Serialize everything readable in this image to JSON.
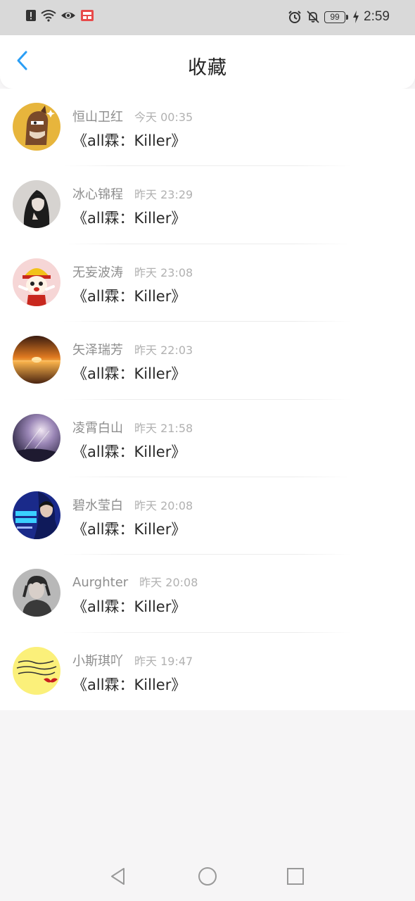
{
  "status_bar": {
    "time": "2:59",
    "battery": "99"
  },
  "header": {
    "title": "收藏"
  },
  "favorites": [
    {
      "username": "恒山卫红",
      "time": "今天 00:35",
      "title": "《all霖：Killer》",
      "avatar": "horse-avatar"
    },
    {
      "username": "冰心锦程",
      "time": "昨天 23:29",
      "title": "《all霖：Killer》",
      "avatar": "dark-hair-girl-avatar"
    },
    {
      "username": "无妄波涛",
      "time": "昨天 23:08",
      "title": "《all霖：Killer》",
      "avatar": "cartoon-kid-avatar"
    },
    {
      "username": "矢泽瑞芳",
      "time": "昨天 22:03",
      "title": "《all霖：Killer》",
      "avatar": "sunset-avatar"
    },
    {
      "username": "凌霄白山",
      "time": "昨天 21:58",
      "title": "《all霖：Killer》",
      "avatar": "sky-light-avatar"
    },
    {
      "username": "碧水莹白",
      "time": "昨天 20:08",
      "title": "《all霖：Killer》",
      "avatar": "poster-avatar"
    },
    {
      "username": "Aurghter",
      "time": "昨天 20:08",
      "title": "《all霖：Killer》",
      "avatar": "person-portrait-avatar"
    },
    {
      "username": "小斯琪吖",
      "time": "昨天 19:47",
      "title": "《all霖：Killer》",
      "avatar": "yellow-note-avatar"
    }
  ],
  "colors": {
    "accent": "#2a9ef5",
    "username": "#8e8e8e",
    "time": "#b1b1b1",
    "title": "#2a2a2a",
    "background": "#f6f5f6"
  },
  "icons": {
    "status_left": [
      "alert-icon",
      "wifi-icon",
      "eye-icon",
      "app-notification-icon"
    ],
    "status_right": [
      "alarm-icon",
      "mute-bell-icon",
      "battery-icon",
      "charging-icon"
    ],
    "nav": [
      "back-arrow-icon"
    ],
    "system": [
      "nav-back-icon",
      "nav-home-icon",
      "nav-recent-icon"
    ]
  }
}
